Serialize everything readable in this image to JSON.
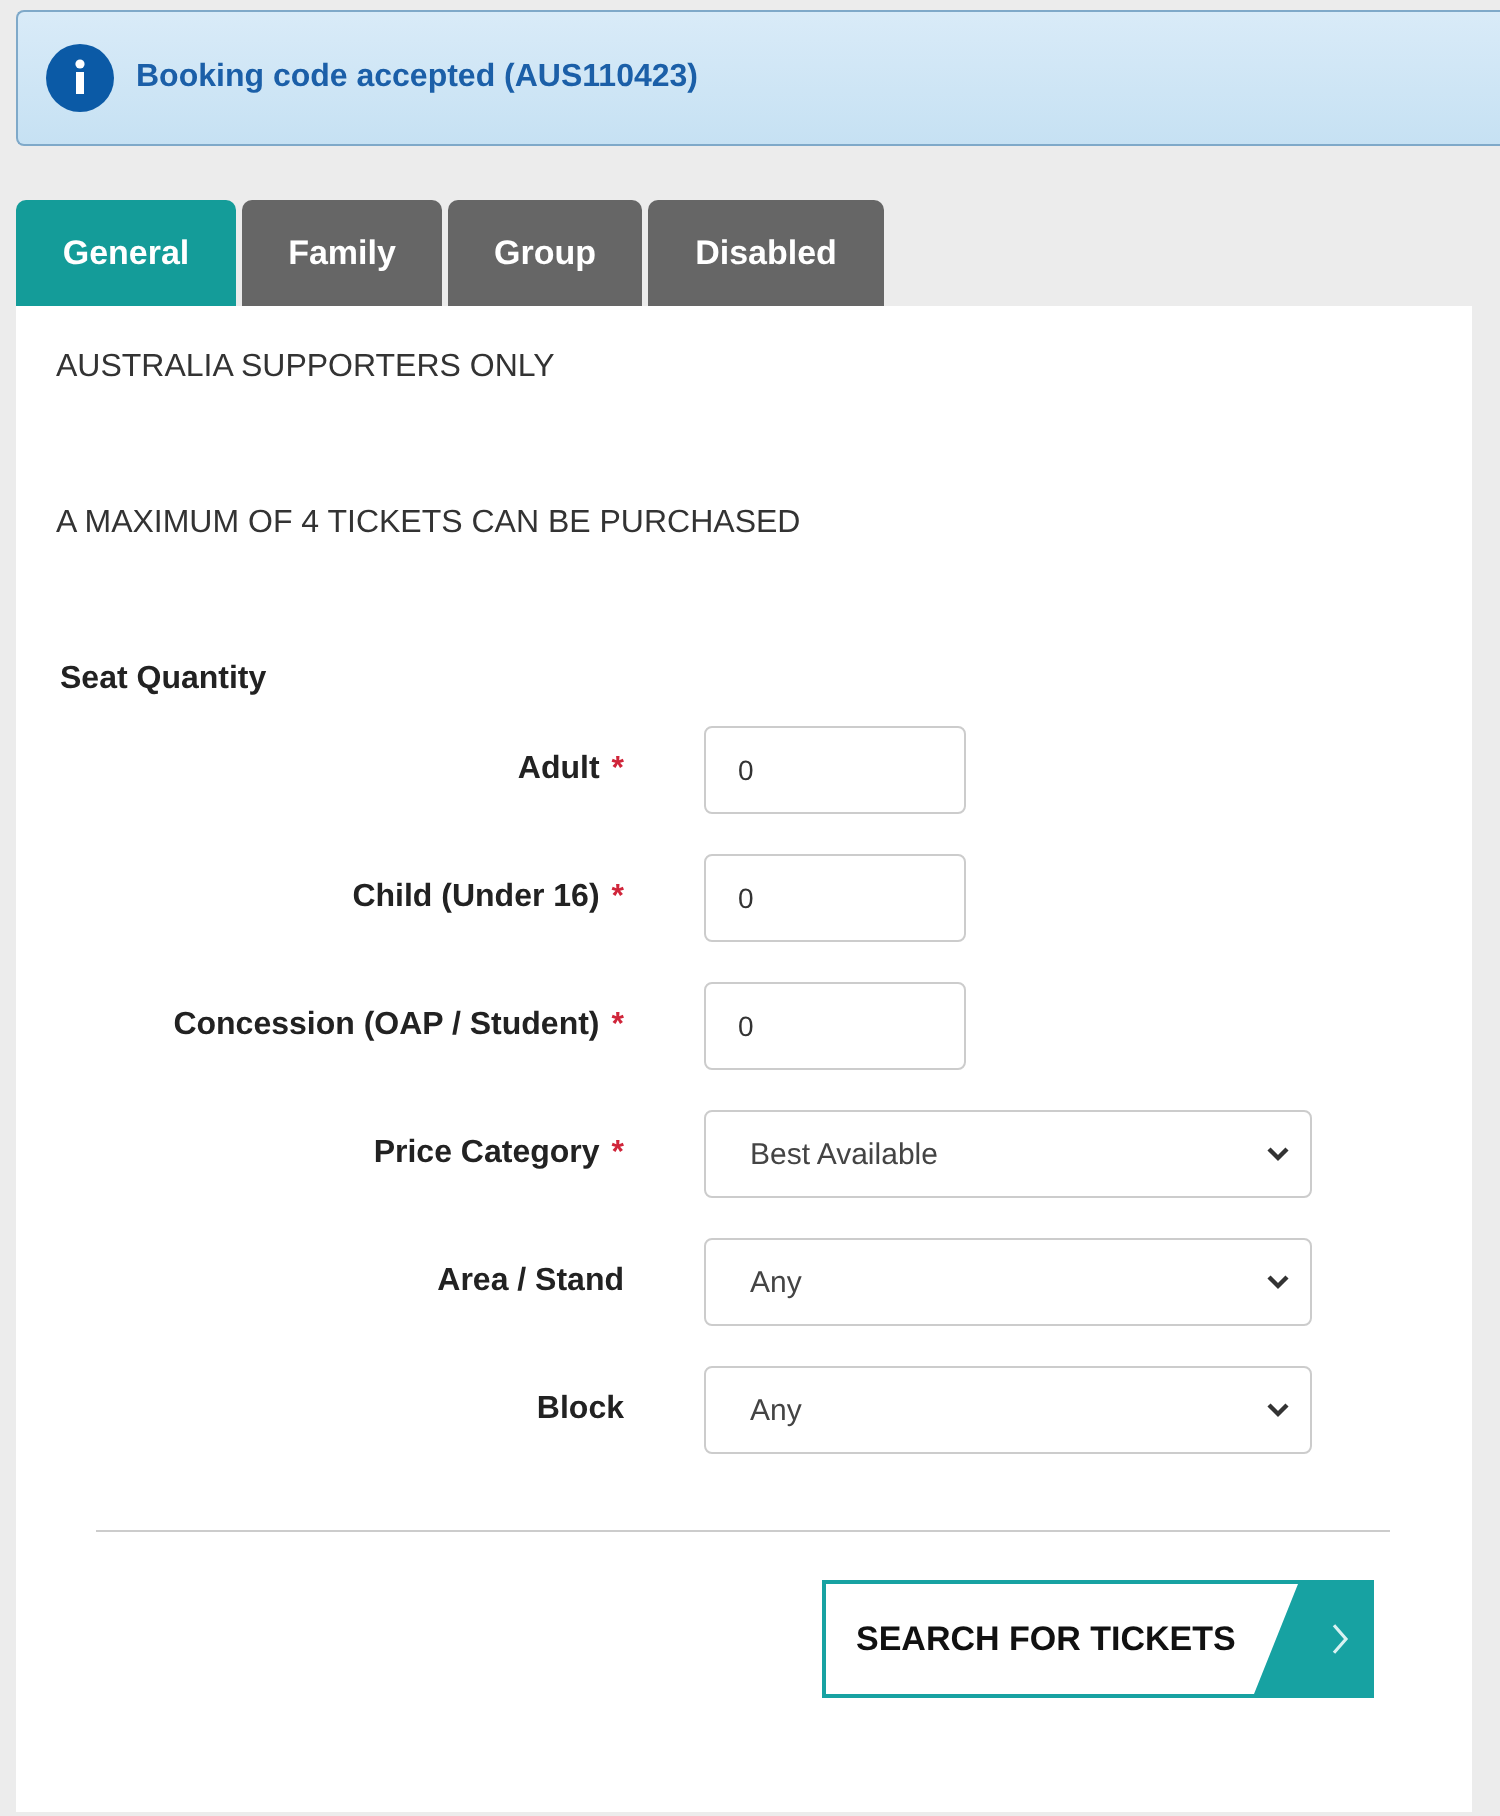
{
  "alert": {
    "text": "Booking code accepted (AUS110423)"
  },
  "tabs": [
    {
      "label": "General",
      "selected": true
    },
    {
      "label": "Family",
      "selected": false
    },
    {
      "label": "Group",
      "selected": false
    },
    {
      "label": "Disabled",
      "selected": false
    }
  ],
  "notices": [
    "AUSTRALIA SUPPORTERS ONLY",
    "A MAXIMUM OF 4 TICKETS CAN BE PURCHASED"
  ],
  "section_title": "Seat Quantity",
  "required_mark": "*",
  "fields": [
    {
      "kind": "number",
      "label": "Adult",
      "required": true,
      "value": "0"
    },
    {
      "kind": "number",
      "label": "Child (Under 16)",
      "required": true,
      "value": "0"
    },
    {
      "kind": "number",
      "label": "Concession (OAP / Student)",
      "required": true,
      "value": "0"
    },
    {
      "kind": "select",
      "label": "Price Category",
      "required": true,
      "value": "Best Available"
    },
    {
      "kind": "select",
      "label": "Area / Stand",
      "required": false,
      "value": "Any"
    },
    {
      "kind": "select",
      "label": "Block",
      "required": false,
      "value": "Any"
    }
  ],
  "button": {
    "label": "SEARCH FOR TICKETS"
  }
}
